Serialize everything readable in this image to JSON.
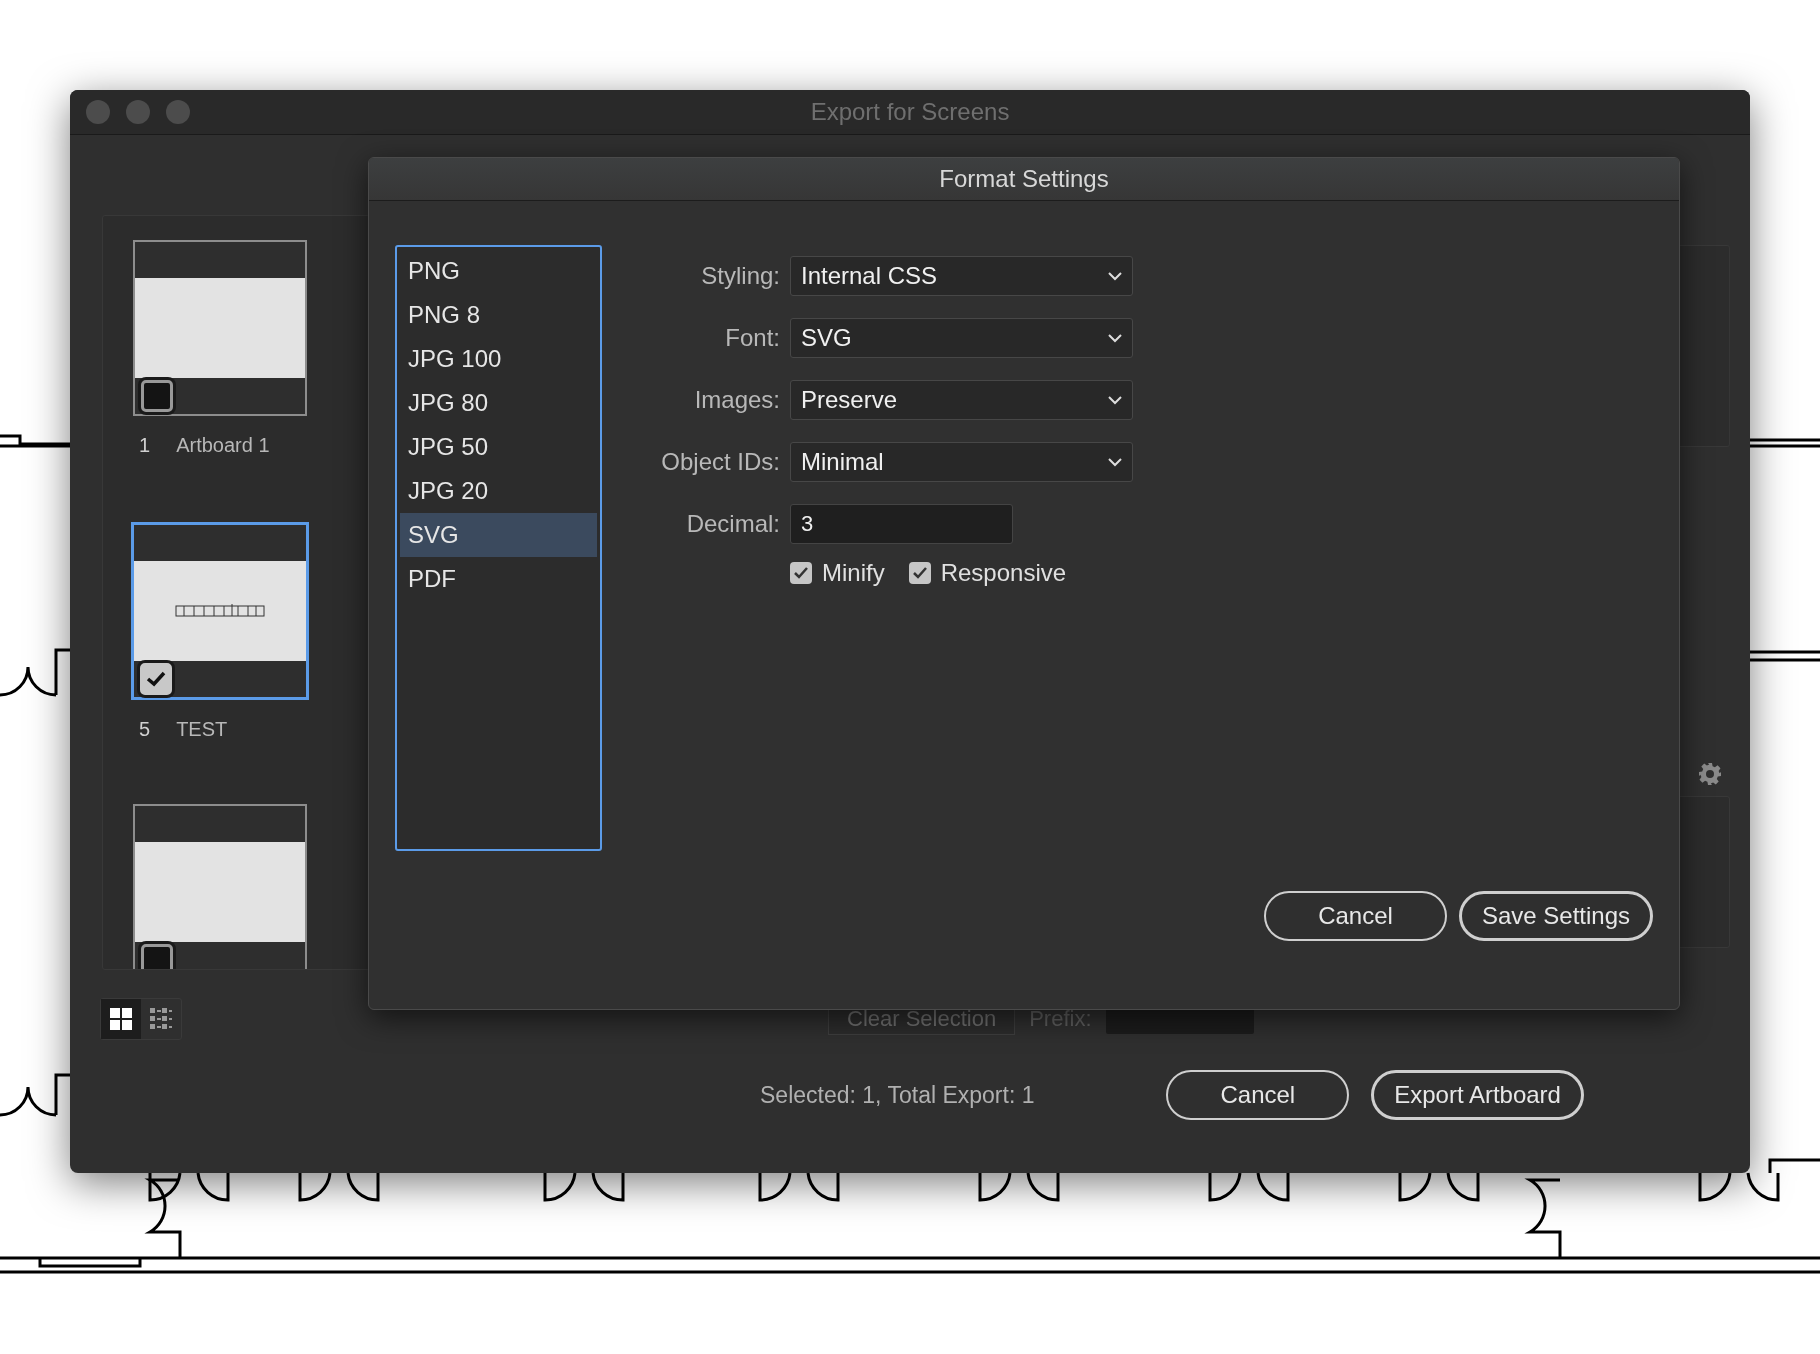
{
  "window": {
    "title": "Export for Screens"
  },
  "artboards": [
    {
      "number": "1",
      "name": "Artboard 1",
      "checked": false,
      "selected": false,
      "kind": "blank"
    },
    {
      "number": "5",
      "name": "TEST",
      "checked": true,
      "selected": true,
      "kind": "plan"
    },
    {
      "checked": false,
      "selected": false,
      "kind": "blank"
    }
  ],
  "view_toggle": [
    {
      "kind": "grid",
      "selected": true
    },
    {
      "kind": "list",
      "selected": false
    }
  ],
  "export_bar": {
    "clear_selection": "Clear Selection",
    "prefix_label": "Prefix:"
  },
  "status": "Selected: 1, Total Export: 1",
  "buttons": [
    {
      "label": "Cancel",
      "primary": false
    },
    {
      "label": "Export Artboard",
      "primary": true
    }
  ],
  "dialog": {
    "title": "Format Settings",
    "formats": [
      {
        "label": "PNG",
        "selected": false
      },
      {
        "label": "PNG 8",
        "selected": false
      },
      {
        "label": "JPG 100",
        "selected": false
      },
      {
        "label": "JPG 80",
        "selected": false
      },
      {
        "label": "JPG 50",
        "selected": false
      },
      {
        "label": "JPG 20",
        "selected": false
      },
      {
        "label": "SVG",
        "selected": true
      },
      {
        "label": "PDF",
        "selected": false
      }
    ],
    "fields": [
      {
        "label": "Styling:",
        "kind": "dropdown",
        "value": "Internal CSS"
      },
      {
        "label": "Font:",
        "kind": "dropdown",
        "value": "SVG"
      },
      {
        "label": "Images:",
        "kind": "dropdown",
        "value": "Preserve"
      },
      {
        "label": "Object IDs:",
        "kind": "dropdown",
        "value": "Minimal"
      },
      {
        "label": "Decimal:",
        "kind": "text",
        "value": "3"
      }
    ],
    "options": [
      {
        "label": "Minify",
        "checked": true
      },
      {
        "label": "Responsive",
        "checked": true
      }
    ],
    "buttons": [
      {
        "label": "Cancel",
        "primary": false
      },
      {
        "label": "Save Settings",
        "primary": true
      }
    ]
  }
}
